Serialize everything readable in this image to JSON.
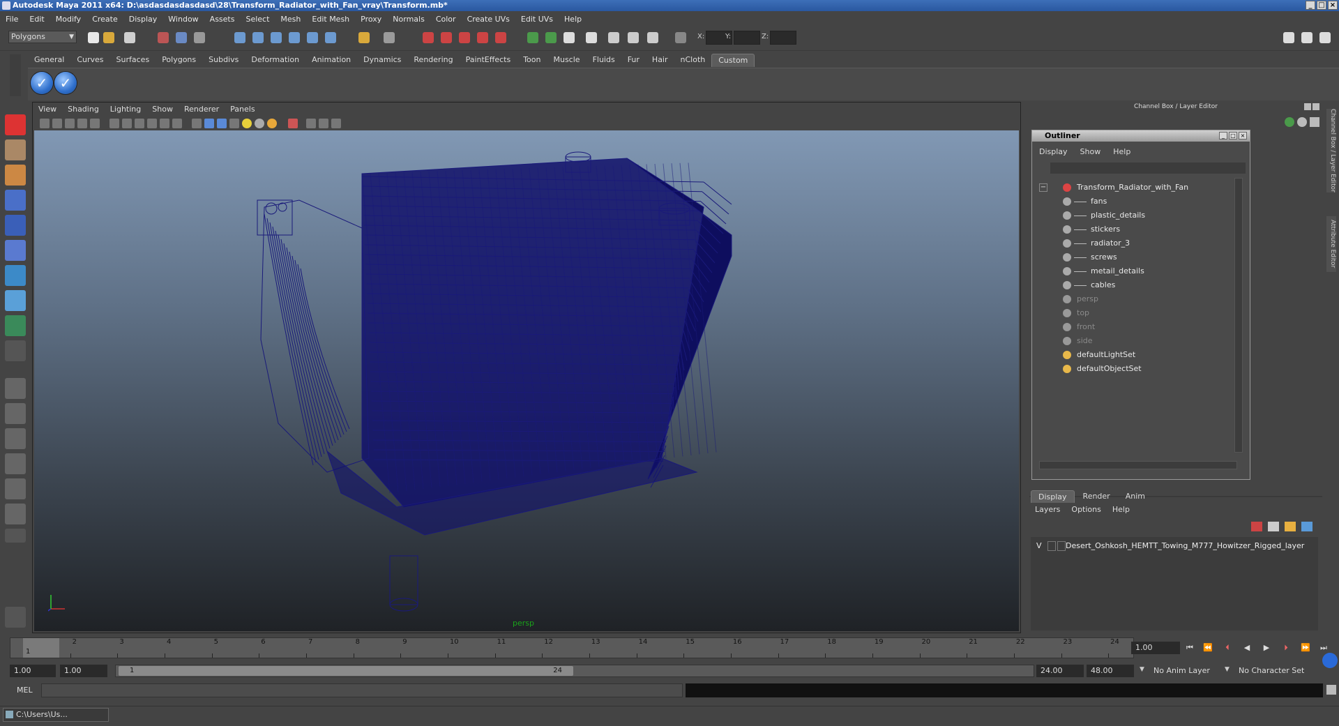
{
  "titlebar": {
    "title": "Autodesk Maya 2011 x64: D:\\asdasdasdasdasd\\28\\Transform_Radiator_with_Fan_vray\\Transform.mb*"
  },
  "menubar": [
    "File",
    "Edit",
    "Modify",
    "Create",
    "Display",
    "Window",
    "Assets",
    "Select",
    "Mesh",
    "Edit Mesh",
    "Proxy",
    "Normals",
    "Color",
    "Create UVs",
    "Edit UVs",
    "Help"
  ],
  "statusline": {
    "mode": "Polygons",
    "x_label": "X:",
    "y_label": "Y:",
    "z_label": "Z:"
  },
  "shelf": {
    "tabs": [
      "General",
      "Curves",
      "Surfaces",
      "Polygons",
      "Subdivs",
      "Deformation",
      "Animation",
      "Dynamics",
      "Rendering",
      "PaintEffects",
      "Toon",
      "Muscle",
      "Fluids",
      "Fur",
      "Hair",
      "nCloth",
      "Custom"
    ],
    "active_tab": "Custom",
    "icons": [
      "check-shelf-icon",
      "check-shelf-icon"
    ]
  },
  "viewport": {
    "menu": [
      "View",
      "Shading",
      "Lighting",
      "Show",
      "Renderer",
      "Panels"
    ],
    "camera": "persp",
    "wire_color": "#1a1a7a"
  },
  "channel_box": {
    "title": "Channel Box / Layer Editor"
  },
  "side_tabs": [
    "Channel Box / Layer Editor",
    "Attribute Editor"
  ],
  "outliner": {
    "title": "Outliner",
    "menu": [
      "Display",
      "Show",
      "Help"
    ],
    "items": [
      {
        "label": "Transform_Radiator_with_Fan",
        "type": "group",
        "level": 0
      },
      {
        "label": "fans",
        "type": "mesh",
        "level": 1
      },
      {
        "label": "plastic_details",
        "type": "mesh",
        "level": 1
      },
      {
        "label": "stickers",
        "type": "mesh",
        "level": 1
      },
      {
        "label": "radiator_3",
        "type": "mesh",
        "level": 1
      },
      {
        "label": "screws",
        "type": "mesh",
        "level": 1
      },
      {
        "label": "metail_details",
        "type": "mesh",
        "level": 1
      },
      {
        "label": "cables",
        "type": "mesh",
        "level": 1
      },
      {
        "label": "persp",
        "type": "camera",
        "level": 0
      },
      {
        "label": "top",
        "type": "camera",
        "level": 0
      },
      {
        "label": "front",
        "type": "camera",
        "level": 0
      },
      {
        "label": "side",
        "type": "camera",
        "level": 0
      },
      {
        "label": "defaultLightSet",
        "type": "set",
        "level": 0
      },
      {
        "label": "defaultObjectSet",
        "type": "set",
        "level": 0
      }
    ]
  },
  "layer_editor": {
    "tabs": [
      "Display",
      "Render",
      "Anim"
    ],
    "active_tab": "Display",
    "menu": [
      "Layers",
      "Options",
      "Help"
    ],
    "layers": [
      {
        "visible": "V",
        "name": "Desert_Oshkosh_HEMTT_Towing_M777_Howitzer_Rigged_layer"
      }
    ]
  },
  "timeline": {
    "ticks": [
      "1",
      "2",
      "3",
      "4",
      "5",
      "6",
      "7",
      "8",
      "9",
      "10",
      "11",
      "12",
      "13",
      "14",
      "15",
      "16",
      "17",
      "18",
      "19",
      "20",
      "21",
      "22",
      "23",
      "24"
    ],
    "current_frame_marker": "1",
    "current_time": "1.00"
  },
  "range": {
    "start_time": "1.00",
    "playback_start": "1.00",
    "range_start_label": "1",
    "range_end_label": "24",
    "playback_end": "24.00",
    "end_time": "48.00",
    "anim_layer": "No Anim Layer",
    "character_set": "No Character Set"
  },
  "commandline": {
    "label": "MEL"
  },
  "taskbar": {
    "item": "C:\\Users\\Us..."
  }
}
